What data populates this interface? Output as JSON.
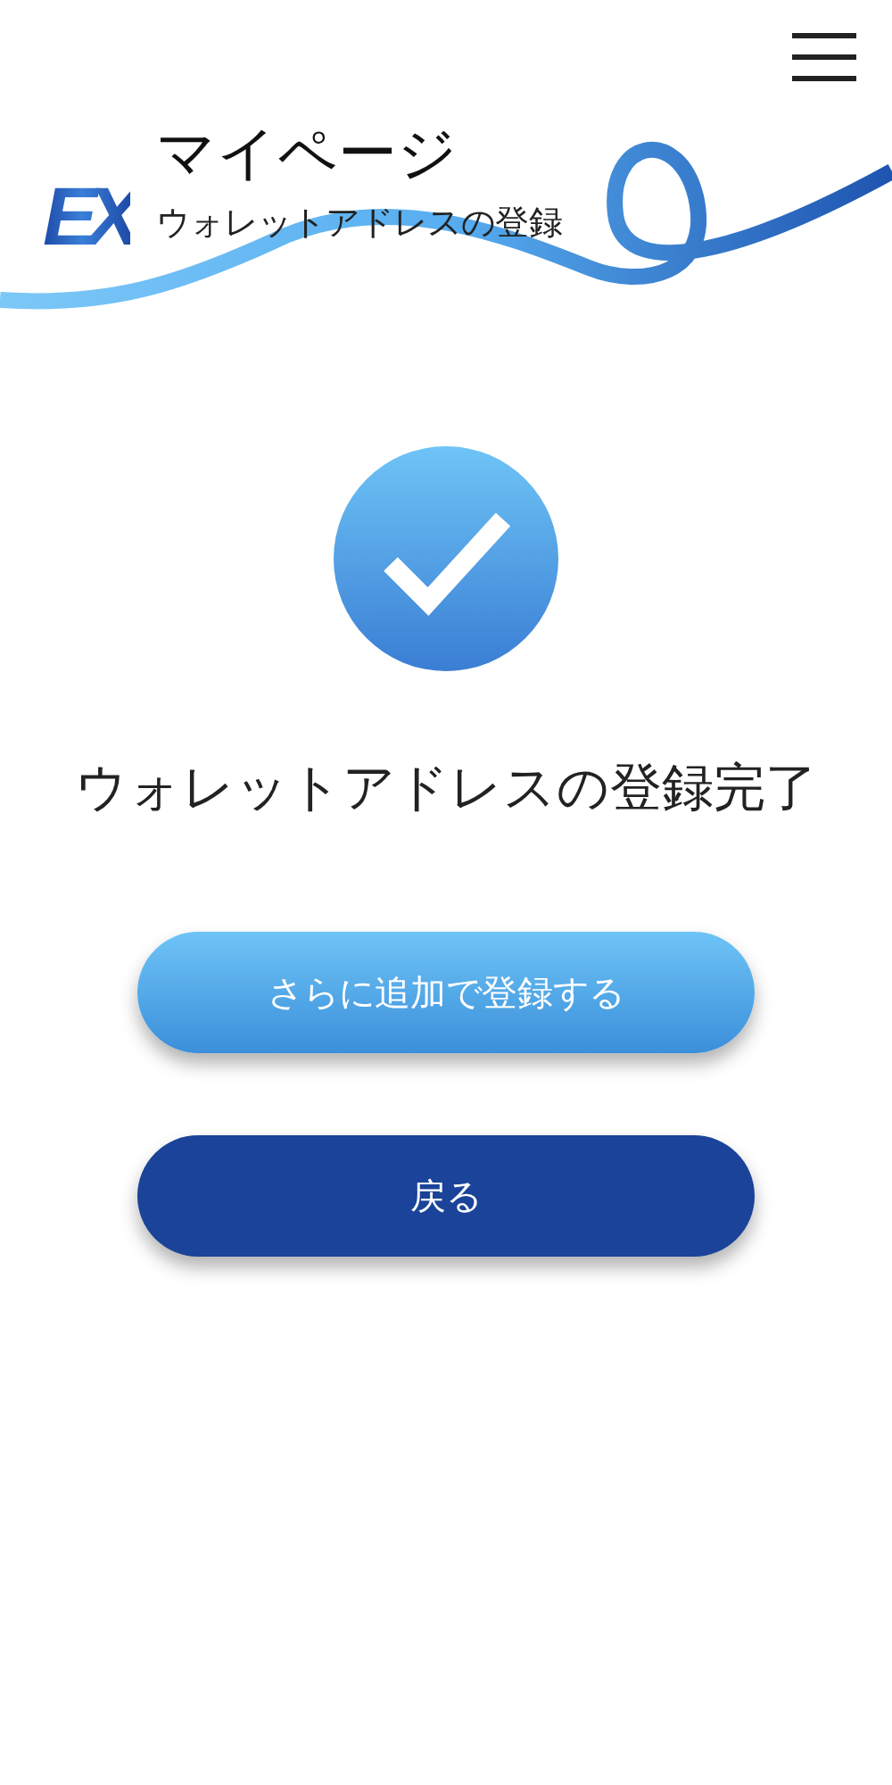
{
  "header": {
    "logo": "EX",
    "title": "マイページ",
    "subtitle": "ウォレットアドレスの登録"
  },
  "message": "ウォレットアドレスの登録完了",
  "buttons": [
    {
      "label": "さらに追加で登録する",
      "kind": "secondary"
    },
    {
      "label": "戻る",
      "kind": "primary"
    }
  ]
}
